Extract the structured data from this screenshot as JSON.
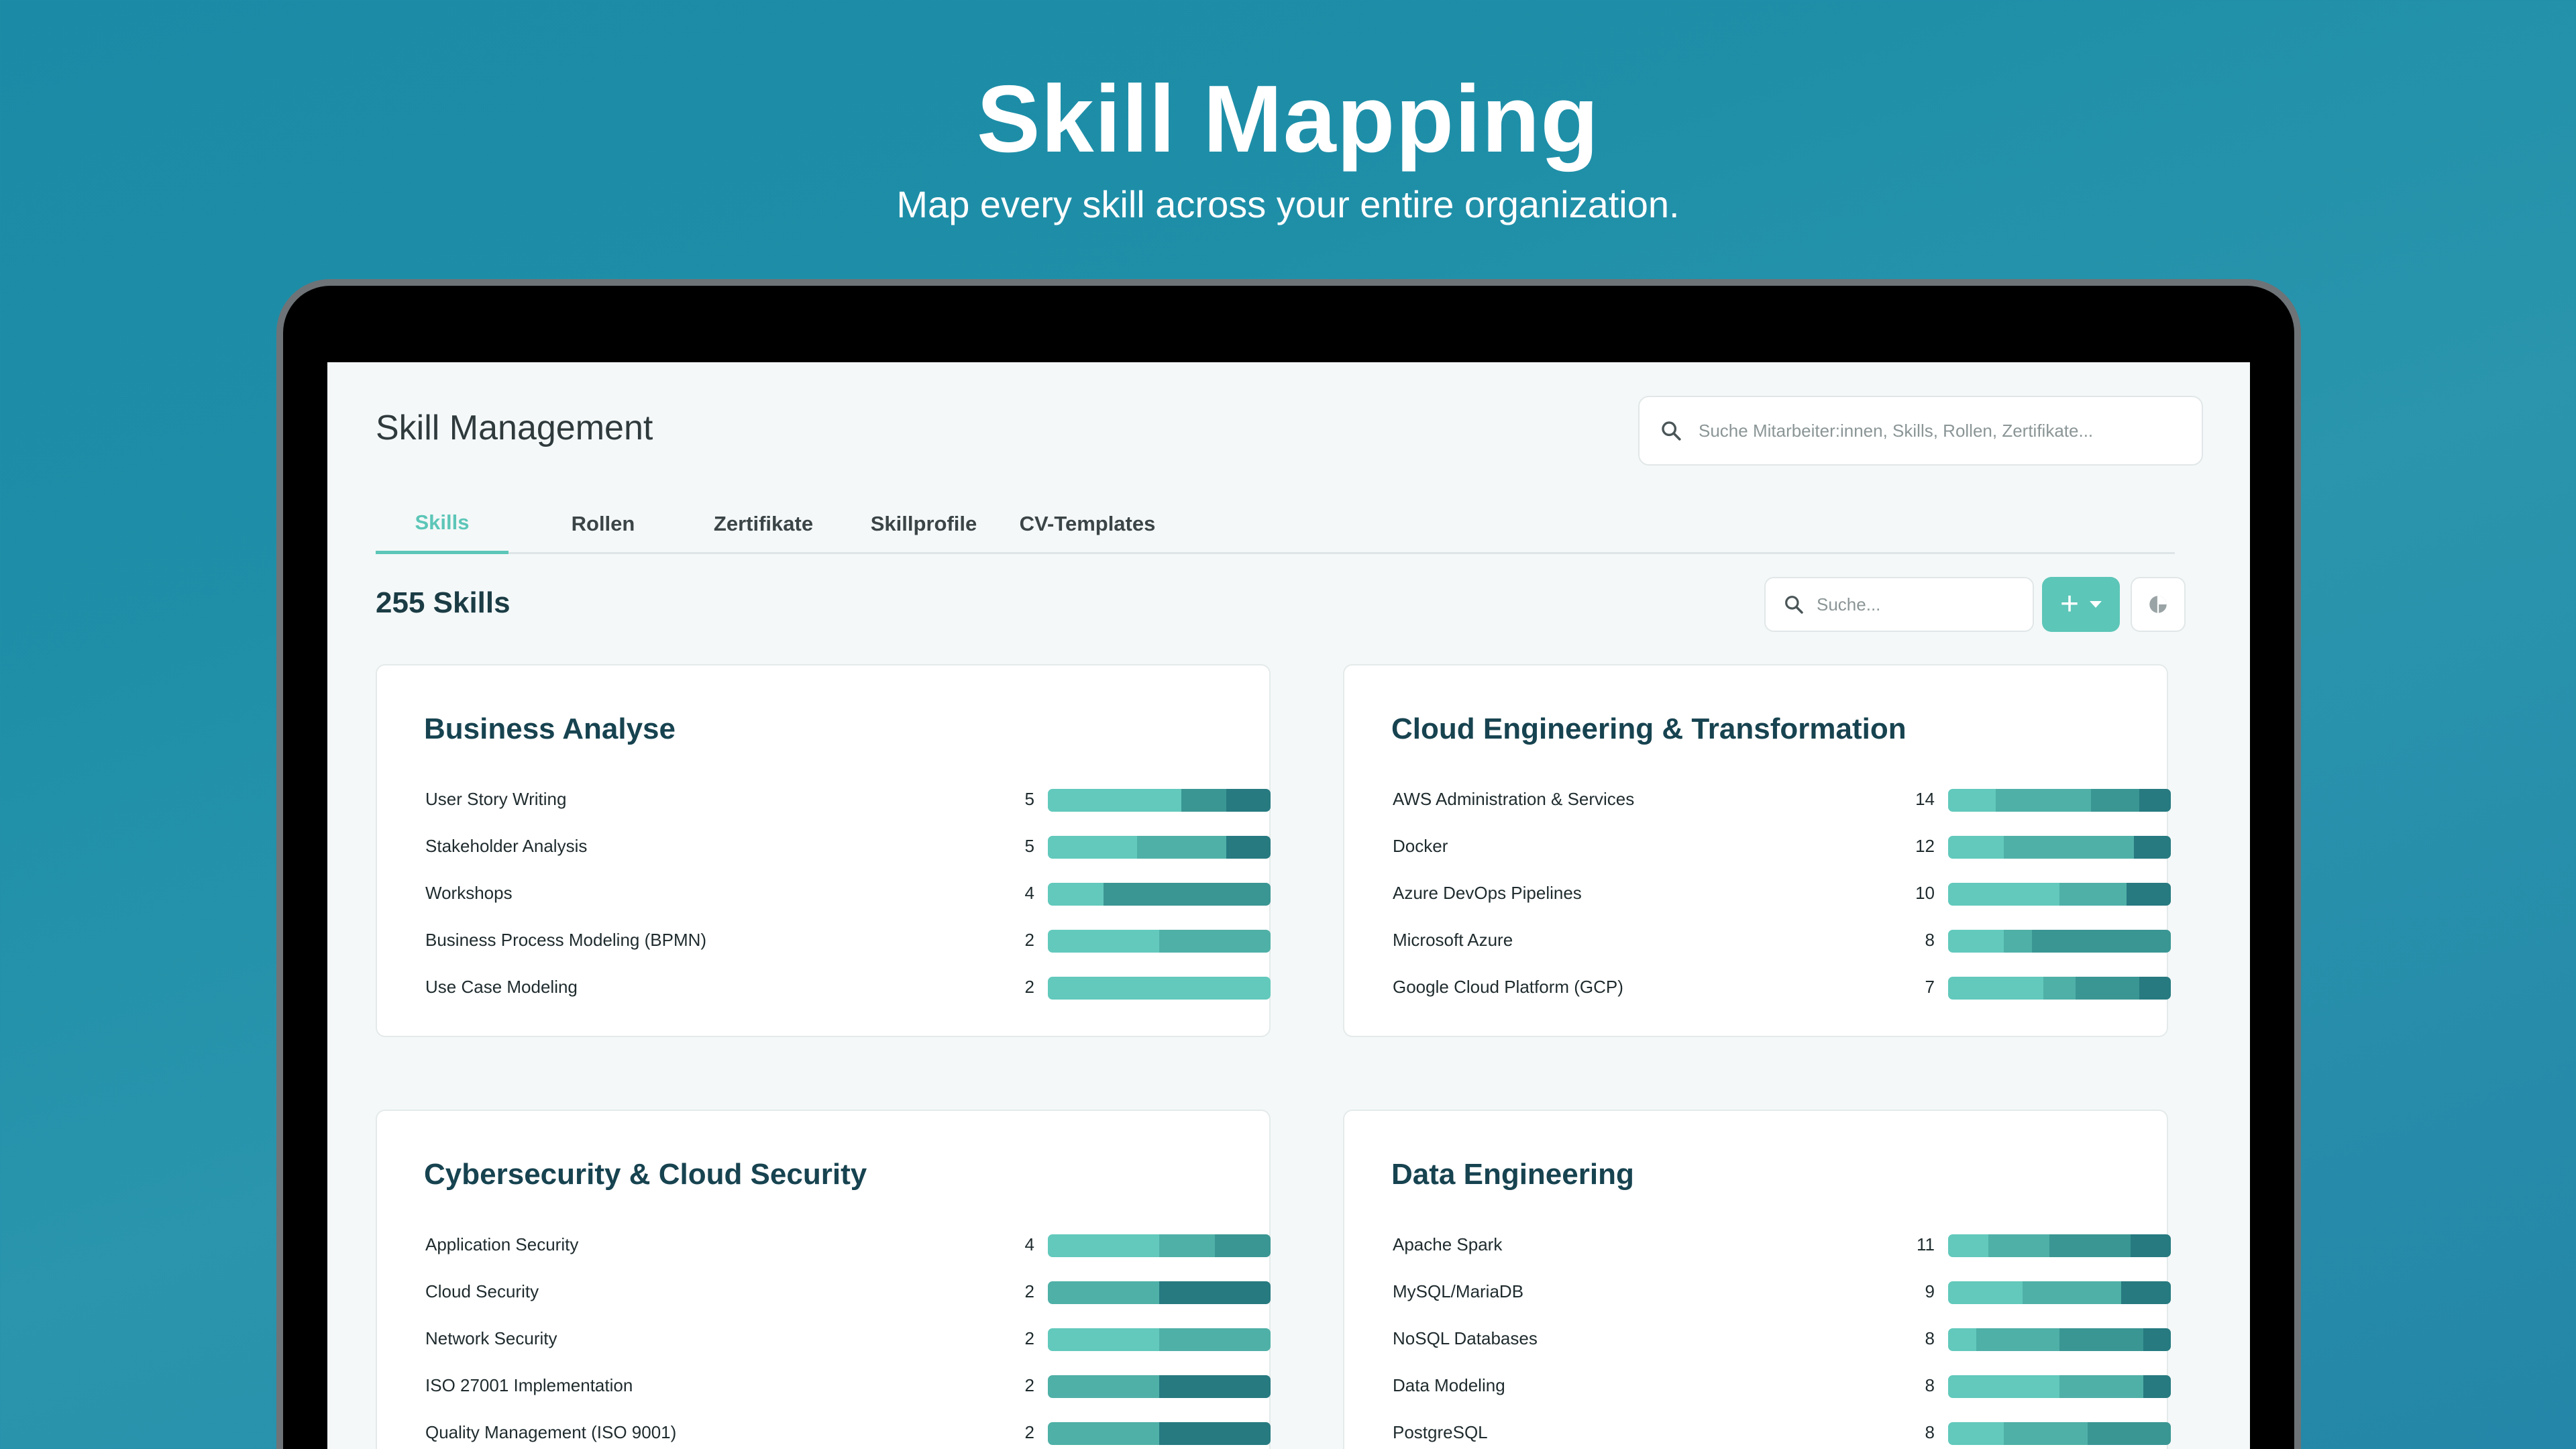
{
  "hero": {
    "title": "Skill Mapping",
    "subtitle": "Map every skill across your entire organization."
  },
  "app": {
    "title": "Skill Management",
    "global_search_placeholder": "Suche Mitarbeiter:innen, Skills, Rollen, Zertifikate..."
  },
  "tabs": [
    {
      "label": "Skills",
      "active": true
    },
    {
      "label": "Rollen",
      "active": false
    },
    {
      "label": "Zertifikate",
      "active": false
    },
    {
      "label": "Skillprofile",
      "active": false
    },
    {
      "label": "CV-Templates",
      "active": false
    }
  ],
  "list": {
    "count_label": "255 Skills",
    "search_placeholder": "Suche..."
  },
  "level_colors": [
    "#62c9bc",
    "#4fb0a7",
    "#3a9693",
    "#267a80"
  ],
  "categories": [
    {
      "title": "Business Analyse",
      "skills": [
        {
          "name": "User Story Writing",
          "count": "5",
          "levels": [
            3,
            0,
            1,
            1
          ]
        },
        {
          "name": "Stakeholder Analysis",
          "count": "5",
          "levels": [
            2,
            2,
            0,
            1
          ]
        },
        {
          "name": "Workshops",
          "count": "4",
          "levels": [
            1,
            0,
            3,
            0
          ]
        },
        {
          "name": "Business Process Modeling (BPMN)",
          "count": "2",
          "levels": [
            1,
            1,
            0,
            0
          ]
        },
        {
          "name": "Use Case Modeling",
          "count": "2",
          "levels": [
            2,
            0,
            0,
            0
          ]
        }
      ]
    },
    {
      "title": "Cloud Engineering & Transformation",
      "skills": [
        {
          "name": "AWS Administration & Services",
          "count": "14",
          "levels": [
            3,
            6,
            3,
            2
          ]
        },
        {
          "name": "Docker",
          "count": "12",
          "levels": [
            3,
            7,
            0,
            2
          ]
        },
        {
          "name": "Azure DevOps Pipelines",
          "count": "10",
          "levels": [
            5,
            3,
            0,
            2
          ]
        },
        {
          "name": "Microsoft Azure",
          "count": "8",
          "levels": [
            2,
            1,
            5,
            0
          ]
        },
        {
          "name": "Google Cloud Platform (GCP)",
          "count": "7",
          "levels": [
            3,
            1,
            2,
            1
          ]
        }
      ]
    },
    {
      "title": "Cybersecurity & Cloud Security",
      "skills": [
        {
          "name": "Application Security",
          "count": "4",
          "levels": [
            2,
            1,
            1,
            0
          ]
        },
        {
          "name": "Cloud Security",
          "count": "2",
          "levels": [
            0,
            1,
            0,
            1
          ]
        },
        {
          "name": "Network Security",
          "count": "2",
          "levels": [
            1,
            1,
            0,
            0
          ]
        },
        {
          "name": "ISO 27001 Implementation",
          "count": "2",
          "levels": [
            0,
            1,
            0,
            1
          ]
        },
        {
          "name": "Quality Management (ISO 9001)",
          "count": "2",
          "levels": [
            0,
            1,
            0,
            1
          ]
        }
      ]
    },
    {
      "title": "Data Engineering",
      "skills": [
        {
          "name": "Apache Spark",
          "count": "11",
          "levels": [
            2,
            3,
            4,
            2
          ]
        },
        {
          "name": "MySQL/MariaDB",
          "count": "9",
          "levels": [
            3,
            4,
            0,
            2
          ]
        },
        {
          "name": "NoSQL Databases",
          "count": "8",
          "levels": [
            1,
            3,
            3,
            1
          ]
        },
        {
          "name": "Data Modeling",
          "count": "8",
          "levels": [
            4,
            3,
            0,
            1
          ]
        },
        {
          "name": "PostgreSQL",
          "count": "8",
          "levels": [
            2,
            3,
            3,
            0
          ]
        }
      ]
    }
  ]
}
